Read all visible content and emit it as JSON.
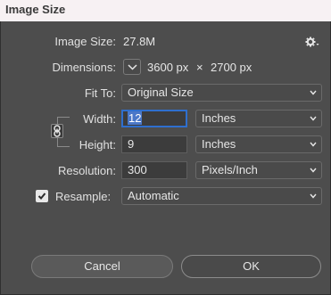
{
  "window": {
    "title": "Image Size"
  },
  "image_size": {
    "label": "Image Size:",
    "value": "27.8M"
  },
  "dimensions": {
    "label": "Dimensions:",
    "width": "3600 px",
    "separator": "×",
    "height": "2700 px"
  },
  "fit_to": {
    "label": "Fit To:",
    "value": "Original Size"
  },
  "width": {
    "label": "Width:",
    "value": "12",
    "unit": "Inches"
  },
  "height": {
    "label": "Height:",
    "value": "9",
    "unit": "Inches"
  },
  "resolution": {
    "label": "Resolution:",
    "value": "300",
    "unit": "Pixels/Inch"
  },
  "resample": {
    "label": "Resample:",
    "checked": true,
    "value": "Automatic"
  },
  "buttons": {
    "cancel": "Cancel",
    "ok": "OK"
  },
  "colors": {
    "focus_ring": "#2f6fce",
    "selection": "#4b78c8",
    "background": "#4d4d4d"
  }
}
